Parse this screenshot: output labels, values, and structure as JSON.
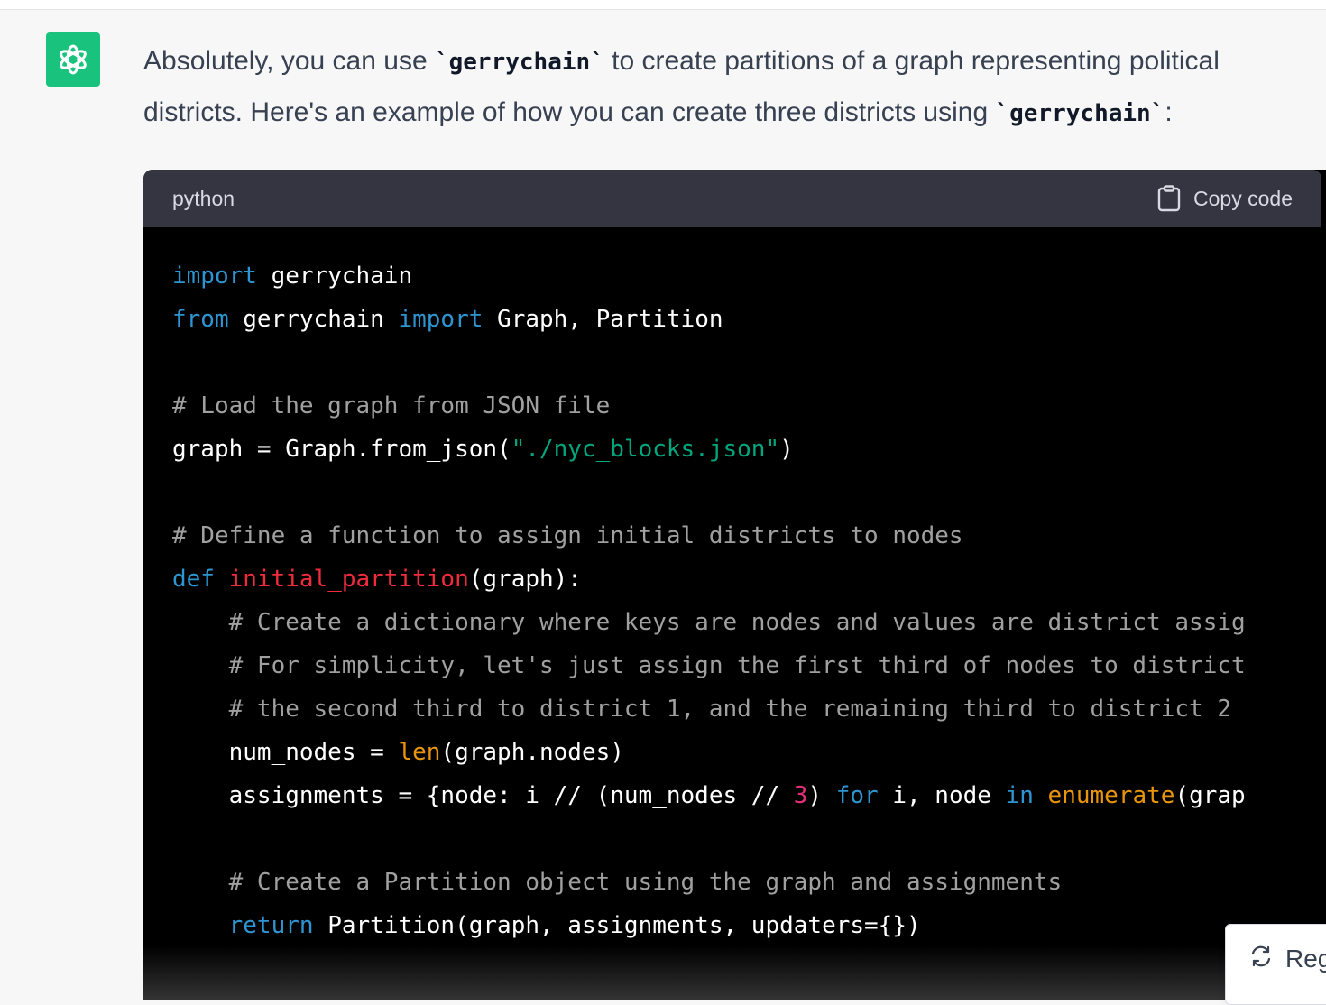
{
  "message": {
    "text_before": "Absolutely, you can use ",
    "code_1": "`gerrychain`",
    "text_middle": " to create partitions of a graph representing political districts. Here's an example of how you can create three districts using ",
    "code_2": "`gerrychain`",
    "text_after": ":"
  },
  "code_block": {
    "language": "python",
    "copy_label": "Copy code",
    "lines": {
      "l1_kw": "import",
      "l1_rest": " gerrychain",
      "l2_kw1": "from",
      "l2_mid": " gerrychain ",
      "l2_kw2": "import",
      "l2_rest": " Graph, Partition",
      "l4": "# Load the graph from JSON file",
      "l5_a": "graph = Graph.from_json(",
      "l5_str": "\"./nyc_blocks.json\"",
      "l5_b": ")",
      "l7": "# Define a function to assign initial districts to nodes",
      "l8_kw": "def",
      "l8_fn": "initial_partition",
      "l8_rest": "(graph):",
      "l9": "    # Create a dictionary where keys are nodes and values are district assig",
      "l10": "    # For simplicity, let's just assign the first third of nodes to district",
      "l11": "    # the second third to district 1, and the remaining third to district 2",
      "l12_a": "    num_nodes = ",
      "l12_bi": "len",
      "l12_b": "(graph.nodes)",
      "l13_a": "    assignments = {node: i // (num_nodes // ",
      "l13_num": "3",
      "l13_b": ") ",
      "l13_kw1": "for",
      "l13_c": " i, node ",
      "l13_kw2": "in",
      "l13_d": " ",
      "l13_bi": "enumerate",
      "l13_e": "(grap",
      "l15": "    # Create a Partition object using the graph and assignments",
      "l16_kw": "return",
      "l16_rest": " Partition(graph, assignments, updaters={})"
    }
  },
  "regenerate_label": "Reg",
  "colors": {
    "avatar_bg": "#19c37d",
    "keyword": "#2e95d3",
    "comment": "#a0a0a0",
    "string": "#00a67d",
    "function": "#f22c3d",
    "builtin": "#e9950c",
    "number": "#df3079"
  },
  "icons": [
    "openai-logo-icon",
    "clipboard-icon",
    "refresh-icon"
  ]
}
